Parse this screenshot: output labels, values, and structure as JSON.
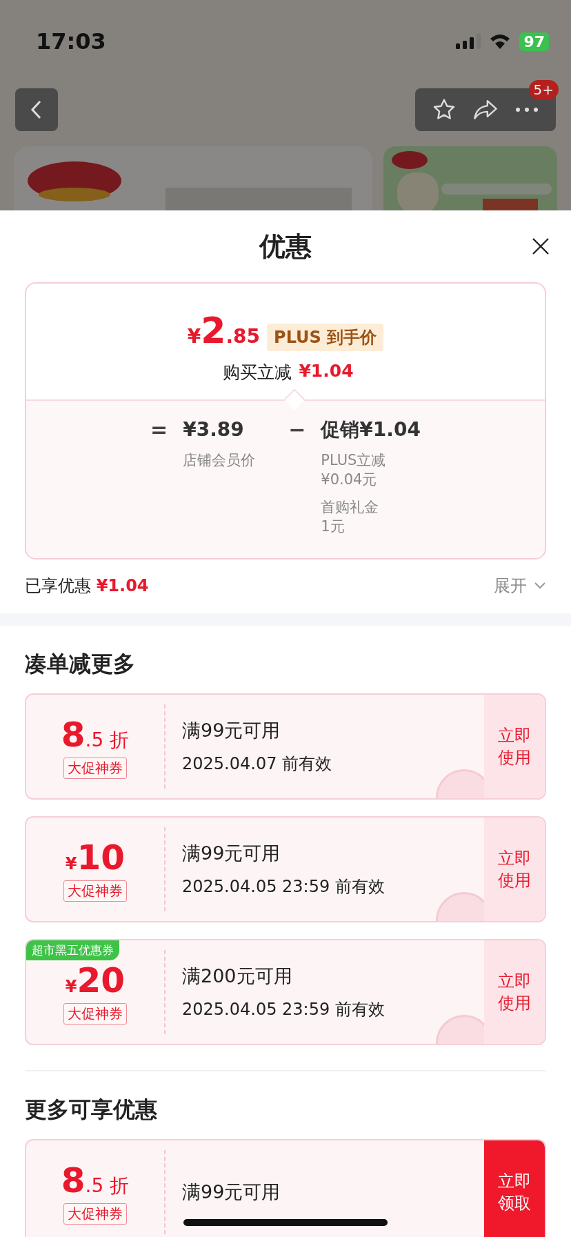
{
  "status_bar": {
    "time": "17:03",
    "battery": "97"
  },
  "nav": {
    "badge": "5+"
  },
  "sheet": {
    "title": "优惠"
  },
  "price_card": {
    "currency": "¥",
    "integer": "2",
    "decimal": ".85",
    "badge": "PLUS 到手价",
    "instant_label": "购买立减",
    "instant_amount": "¥1.04",
    "equals": "=",
    "base_price": "¥3.89",
    "base_label": "店铺会员价",
    "minus": "−",
    "promo_title": "促销¥1.04",
    "promo_details": [
      {
        "name": "PLUS立减",
        "amount": "¥0.04元"
      },
      {
        "name": "首购礼金",
        "amount": "1元"
      }
    ]
  },
  "savings": {
    "label": "已享优惠",
    "amount": "¥1.04",
    "expand": "展开"
  },
  "sections": [
    {
      "title": "凑单减更多",
      "coupons": [
        {
          "kind": "discount",
          "big": "8",
          "small": ".5",
          "unit": "折",
          "tag": "大促神券",
          "condition": "满99元可用",
          "validity": "2025.04.07 前有效",
          "action": "立即使用",
          "claimed": true
        },
        {
          "kind": "cash",
          "currency": "¥",
          "big": "10",
          "tag": "大促神券",
          "condition": "满99元可用",
          "validity": "2025.04.05 23:59 前有效",
          "action": "立即使用",
          "claimed": true
        },
        {
          "kind": "cash",
          "currency": "¥",
          "big": "20",
          "tag": "大促神券",
          "ribbon": "超市黑五优惠券",
          "condition": "满200元可用",
          "validity": "2025.04.05 23:59 前有效",
          "action": "立即使用",
          "claimed": true
        }
      ]
    },
    {
      "title": "更多可享优惠",
      "coupons": [
        {
          "kind": "discount",
          "big": "8",
          "small": ".5",
          "unit": "折",
          "tag": "大促神券",
          "condition": "满99元可用",
          "action": "立即领取",
          "claimed": false
        }
      ]
    }
  ]
}
